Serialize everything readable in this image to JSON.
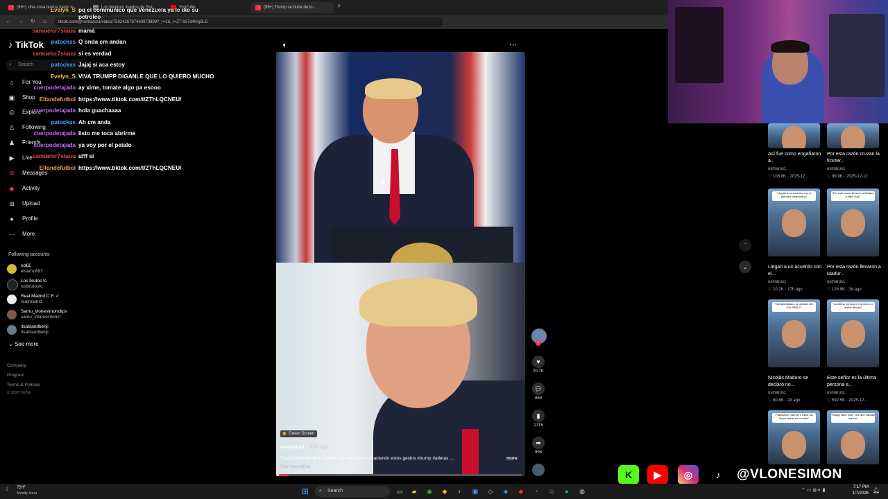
{
  "browser": {
    "tabs": [
      {
        "label": "(99+) Una cosa buena luego la..."
      },
      {
        "label": "Los Mejores Juegos de Grá..."
      },
      {
        "label": "YouTube"
      },
      {
        "label": "(99+) Trump se burla de lo..."
      }
    ],
    "url": "tiktok.com/@osmarus1/video/7592426787460973999?_r=1&_t=ZT-927d40rg5LD"
  },
  "tiktok": {
    "logo": "TikTok",
    "search_placeholder": "Search",
    "nav": [
      {
        "label": "For You",
        "icon": "home-icon"
      },
      {
        "label": "Shop",
        "icon": "shop-icon"
      },
      {
        "label": "Explore",
        "icon": "compass-icon"
      },
      {
        "label": "Following",
        "icon": "following-icon"
      },
      {
        "label": "Friends",
        "icon": "friends-icon"
      },
      {
        "label": "Live",
        "icon": "live-icon"
      },
      {
        "label": "Messages",
        "icon": "messages-icon"
      },
      {
        "label": "Activity",
        "icon": "activity-icon"
      },
      {
        "label": "Upload",
        "icon": "upload-icon"
      },
      {
        "label": "Profile",
        "icon": "profile-icon"
      },
      {
        "label": "More",
        "icon": "more-icon"
      }
    ],
    "following_title": "Following accounts",
    "accounts": [
      {
        "name": "ꜱσ££",
        "handle": "elsamu697"
      },
      {
        "name": "Los brutos fc",
        "handle": "losbrutosfc"
      },
      {
        "name": "Real Madrid C.F.",
        "handle": "realmadrid"
      },
      {
        "name": "Samu_vlonesimonclips",
        "handle": "samu_vlonesimoncl"
      },
      {
        "name": "itsabiandbenji",
        "handle": "itsabiandbenji"
      }
    ],
    "see_more": "See more",
    "footer": [
      "Company",
      "Program",
      "Terms & Policies",
      "© 2026 TikTok"
    ]
  },
  "chat": [
    {
      "user": "Evelyn_S",
      "color": "#f2c94c",
      "msg": "pq el communico que Venezuela ya le dio su petroleo"
    },
    {
      "user": "samuelcr7siuuu",
      "color": "#e04b4b",
      "msg": "mamá"
    },
    {
      "user": "patockss",
      "color": "#4aa8ff",
      "msg": "Q onda cm andan"
    },
    {
      "user": "samuelcr7siuuu",
      "color": "#e04b4b",
      "msg": "si es verdad"
    },
    {
      "user": "patockss",
      "color": "#4aa8ff",
      "msg": "Jajaj si aca estoy"
    },
    {
      "user": "Evelyn_S",
      "color": "#f2c94c",
      "msg": "VIVA TRUMPP DIGANLE QUE LO QUIERO MUCHO"
    },
    {
      "user": "cuerpodetajada",
      "color": "#c46bff",
      "msg": "ay xime, tomate algo pa esooo"
    },
    {
      "user": "Elfandefutbol",
      "color": "#f2994a",
      "msg": "https://www.tiktok.com/t/ZThLQCNEU/"
    },
    {
      "user": "cuerpodetajada",
      "color": "#c46bff",
      "msg": "hola guachaaaa"
    },
    {
      "user": "patockss",
      "color": "#4aa8ff",
      "msg": "Ah cm anda"
    },
    {
      "user": "cuerpodetajada",
      "color": "#c46bff",
      "msg": "listo me toca abrirme"
    },
    {
      "user": "cuerpodetajada",
      "color": "#c46bff",
      "msg": "ya voy por el petalo"
    },
    {
      "user": "samuelcr7siuuu",
      "color": "#e04b4b",
      "msg": "ufff si"
    },
    {
      "user": "Elfandefutbol",
      "color": "#f2994a",
      "msg": "https://www.tiktok.com/t/ZThLQCNEU/"
    }
  ],
  "video": {
    "badge": "Green Screen",
    "author": "osmarus1",
    "age": "22h ago",
    "description": "Trump se burla de los atletas donde se le vio haciendo estos gestos #trump #atletas ...",
    "more": "more",
    "translation": "See translation",
    "likes": "20.7K",
    "comments": "869",
    "saves": "1715",
    "shares": "996"
  },
  "related": [
    {
      "title": "Así fue como engañaron a...",
      "author": "osmarus1",
      "likes": "108.8K",
      "date": "2025-12..."
    },
    {
      "title": "Por esta razón cruzan la fronter...",
      "author": "osmarus1",
      "likes": "99.9K",
      "date": "2025-12-12"
    },
    {
      "title": "Llegan a un acuerdo con el...",
      "author": "osmarus1",
      "likes": "10.2K",
      "date": "17h ago",
      "caption": "\"Llegan a un acuerdo con el petroleo venezolano\""
    },
    {
      "title": "Por esta razón llevaron a Madur...",
      "author": "osmarus1",
      "likes": "126.9K",
      "date": "3d ago",
      "caption": "\"Por esta razón llevaron a Maduro a New York\""
    },
    {
      "title": "Nicolás Maduro se declaró no...",
      "author": "osmarus1",
      "likes": "80.6K",
      "date": "2d ago",
      "caption": "\"Nicolás Maduro se declaró NO CULPABLE\""
    },
    {
      "title": "Este señor es la última persona e...",
      "author": "osmarus1",
      "likes": "592.5K",
      "date": "2025-12...",
      "caption": "\"La última persona en la tierra en recibir Bitcoin\""
    },
    {
      "title": "",
      "author": "",
      "likes": "",
      "date": "",
      "caption": "\"Fabricaron más de 1 millón de libros falsos en la India\""
    },
    {
      "title": "",
      "author": "",
      "likes": "",
      "date": "",
      "caption": "\"Happy New Year\" Les dice Nicolás maduro"
    }
  ],
  "stream": {
    "handle": "@VLONESIMON",
    "socials": [
      "kick-icon",
      "youtube-icon",
      "instagram-icon",
      "tiktok-icon"
    ]
  },
  "taskbar": {
    "weather_temp": "73°F",
    "weather_desc": "Mostly clear",
    "search": "Search",
    "time": "7:17 PM",
    "date": "1/7/2026"
  },
  "colors": {
    "like": "#fe2c55",
    "kick": "#53fc18",
    "youtube": "#ff0000",
    "instagram": "#d62976"
  }
}
